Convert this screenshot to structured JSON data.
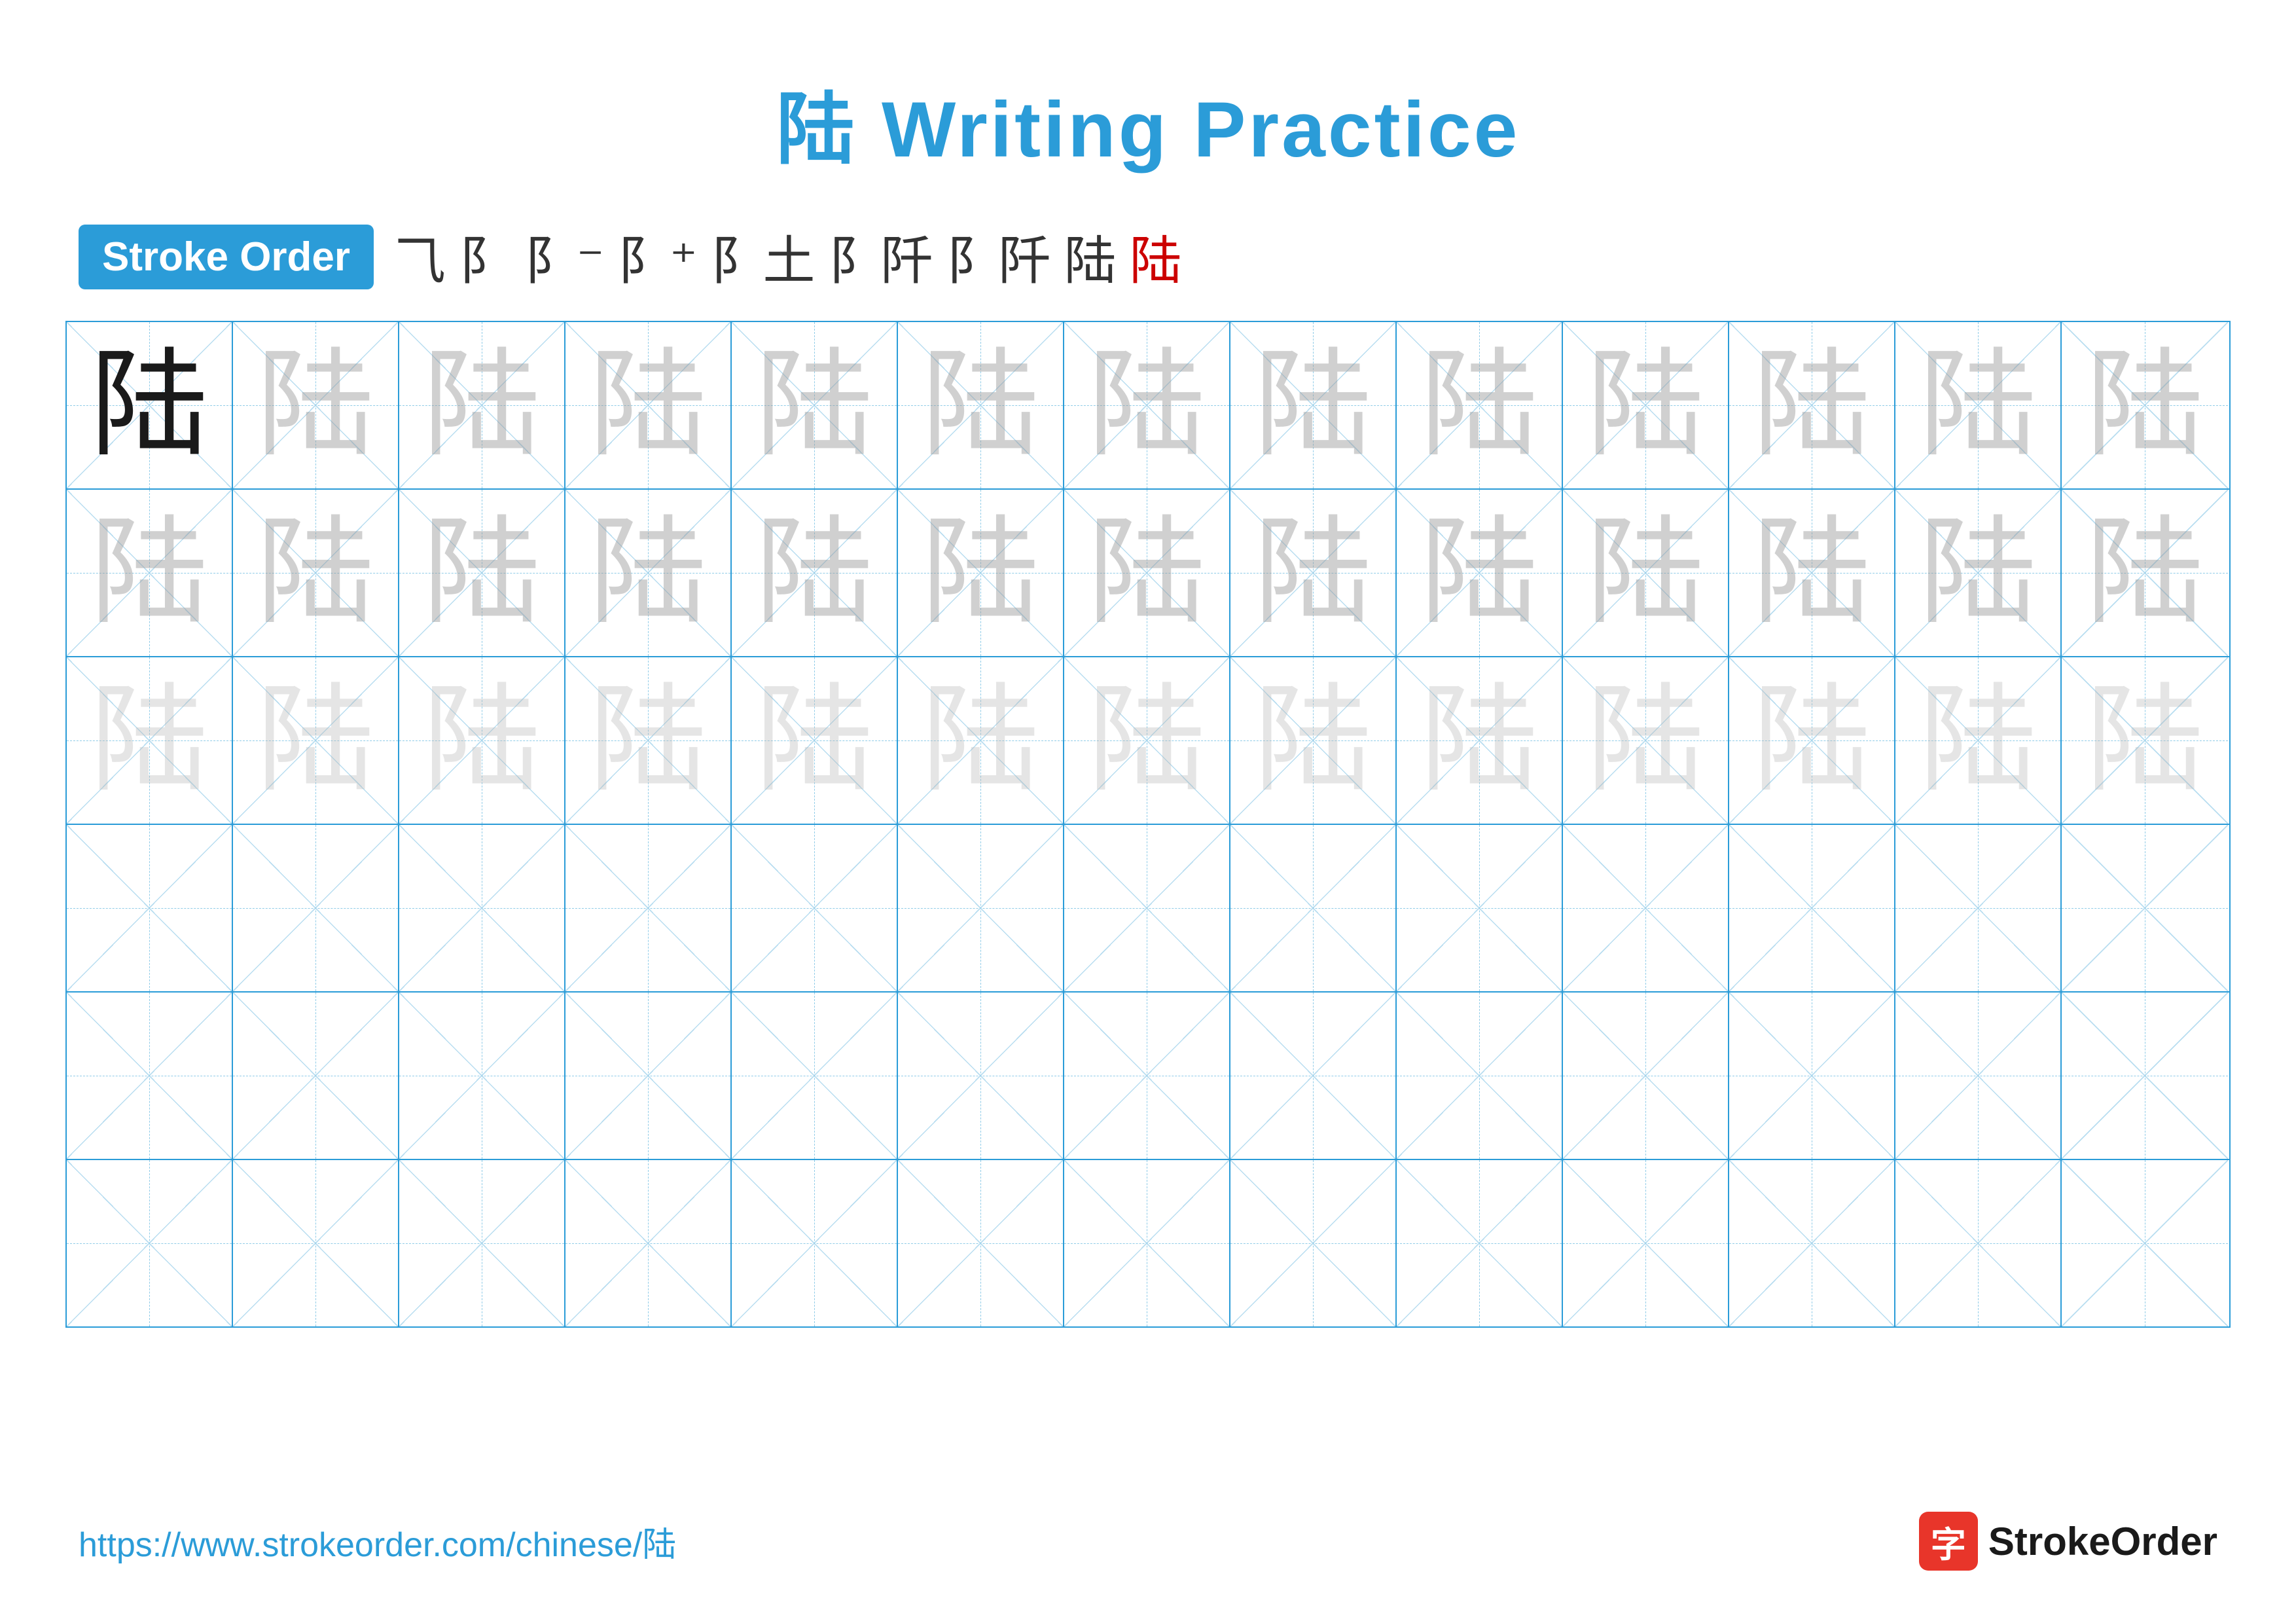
{
  "title": "陆 Writing Practice",
  "stroke_order": {
    "label": "Stroke Order",
    "steps": [
      "⺄",
      "阝",
      "阝⁻",
      "阝⁺",
      "阝土",
      "阝阡",
      "阝阡",
      "陆",
      "陆"
    ],
    "red_index": 8
  },
  "character": "陆",
  "grid": {
    "rows": 6,
    "cols": 13,
    "row_types": [
      "dark_first",
      "light1",
      "light2",
      "empty",
      "empty",
      "empty"
    ]
  },
  "footer": {
    "url": "https://www.strokeorder.com/chinese/陆",
    "logo_icon": "字",
    "logo_text": "StrokeOrder"
  }
}
